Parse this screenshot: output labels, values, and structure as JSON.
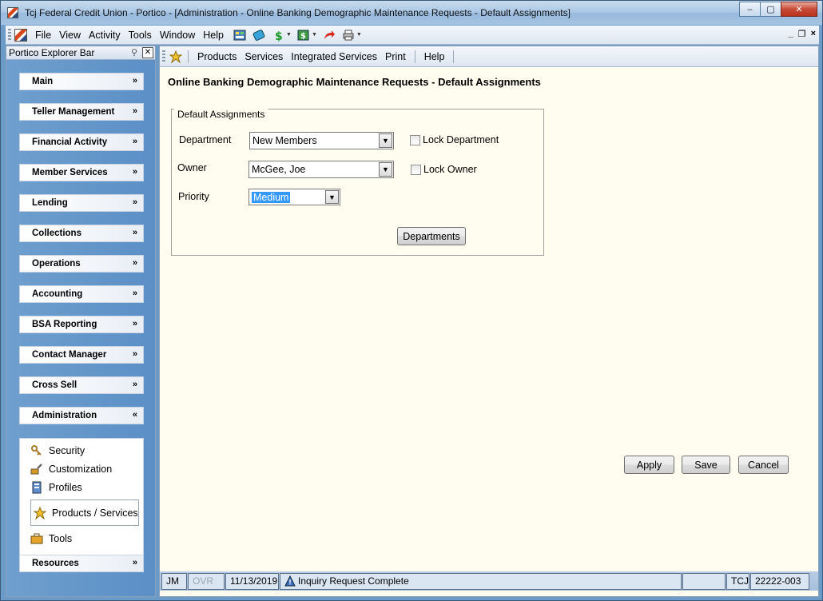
{
  "window": {
    "title": "Tcj Federal Credit Union - Portico - [Administration - Online Banking Demographic Maintenance Requests - Default Assignments]",
    "minimize": "–",
    "maximize": "▢",
    "close": "✕"
  },
  "menubar": {
    "items": [
      "File",
      "View",
      "Activity",
      "Tools",
      "Window",
      "Help"
    ],
    "mdi": {
      "minimize": "_",
      "restore": "❐",
      "close": "×"
    }
  },
  "explorer": {
    "title": "Portico Explorer Bar",
    "groups": [
      "Main",
      "Teller Management",
      "Financial Activity",
      "Member Services",
      "Lending",
      "Collections",
      "Operations",
      "Accounting",
      "BSA Reporting",
      "Contact Manager",
      "Cross Sell",
      "Administration",
      "Resources"
    ],
    "admin_items": [
      "Security",
      "Customization",
      "Profiles",
      "Products / Services",
      "Tools"
    ]
  },
  "subtoolbar": {
    "items": [
      "Products",
      "Services",
      "Integrated Services",
      "Print",
      "Help"
    ]
  },
  "page": {
    "title": "Online Banking Demographic Maintenance Requests - Default Assignments",
    "group_label": "Default Assignments",
    "department": {
      "label": "Department",
      "value": "New Members",
      "lock_label": "Lock Department"
    },
    "owner": {
      "label": "Owner",
      "value": "McGee, Joe",
      "lock_label": "Lock Owner"
    },
    "priority": {
      "label": "Priority",
      "value": "Medium"
    },
    "departments_button": "Departments",
    "apply": "Apply",
    "save": "Save",
    "cancel": "Cancel"
  },
  "status": {
    "user": "JM",
    "ovr": "OVR",
    "date": "11/13/2019",
    "message": "Inquiry Request Complete",
    "blank": "",
    "cu": "TCJ",
    "station": "22222-003"
  }
}
